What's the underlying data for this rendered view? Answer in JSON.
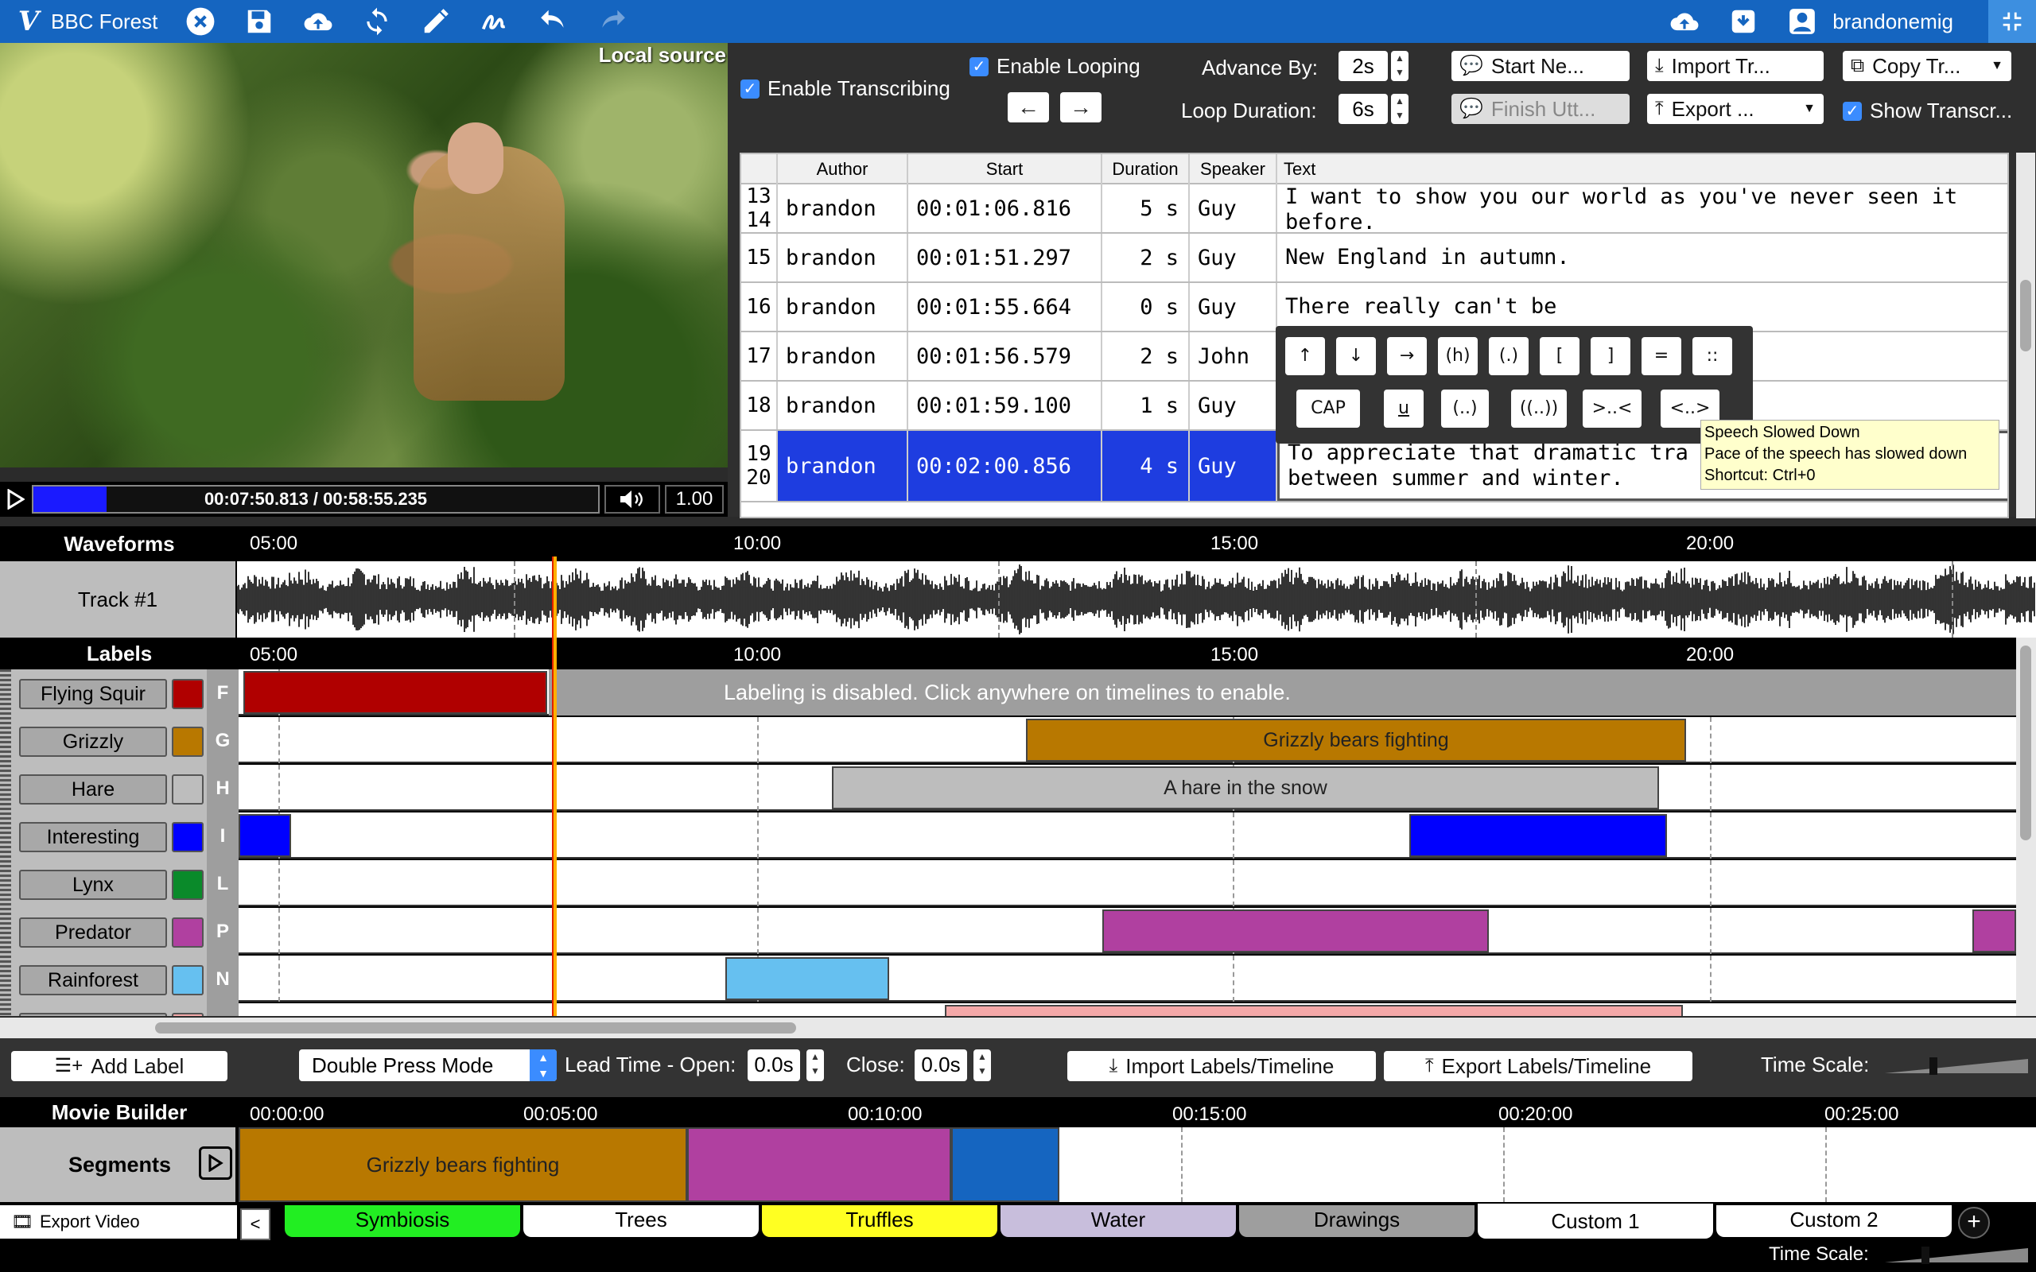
{
  "app": {
    "title": "BBC Forest",
    "user": "brandonemig"
  },
  "video": {
    "source_label": "Local source",
    "timecode": "00:07:50.813 / 00:58:55.235",
    "progress": 0.13,
    "rate": "1.00"
  },
  "transcription": {
    "enable_transcribing": "Enable Transcribing",
    "enable_looping": "Enable Looping",
    "advance_by_label": "Advance By:",
    "advance_by_value": "2s",
    "loop_duration_label": "Loop Duration:",
    "loop_duration_value": "6s",
    "start_new": "Start Ne...",
    "finish_utt": "Finish Utt...",
    "import_tr": "Import Tr...",
    "export": "Export ...",
    "copy_tr": "Copy Tr...",
    "show_transcr": "Show Transcr..."
  },
  "table": {
    "headers": [
      "Author",
      "Start",
      "Duration",
      "Speaker",
      "Text"
    ],
    "rows": [
      {
        "num": "13\n14",
        "author": "brandon",
        "start": "00:01:06.816",
        "duration": "5 s",
        "speaker": "Guy",
        "text": "I want to show you our world as you've never seen it before."
      },
      {
        "num": "15",
        "author": "brandon",
        "start": "00:01:51.297",
        "duration": "2 s",
        "speaker": "Guy",
        "text": "New England in autumn."
      },
      {
        "num": "16",
        "author": "brandon",
        "start": "00:01:55.664",
        "duration": "0 s",
        "speaker": "Guy",
        "text": "There really can't be"
      },
      {
        "num": "17",
        "author": "brandon",
        "start": "00:01:56.579",
        "duration": "2 s",
        "speaker": "John",
        "text": ""
      },
      {
        "num": "18",
        "author": "brandon",
        "start": "00:01:59.100",
        "duration": "1 s",
        "speaker": "Guy",
        "text": ""
      },
      {
        "num": "19\n20",
        "author": "brandon",
        "start": "00:02:00.856",
        "duration": "4 s",
        "speaker": "Guy",
        "text": "To appreciate that dramatic tra\nbetween summer and winter."
      }
    ]
  },
  "palette": {
    "row1": [
      "↑",
      "↓",
      "→",
      "(h)",
      "(.)",
      "[",
      "]",
      "=",
      "::"
    ],
    "row2": [
      "CAP",
      "u",
      "(..)",
      "((..))",
      ">..<",
      "<..>"
    ]
  },
  "tooltip": {
    "title": "Speech Slowed Down",
    "desc": "Pace of the speech has slowed down",
    "shortcut": "Shortcut: Ctrl+0"
  },
  "waveforms": {
    "header": "Waveforms",
    "track": "Track #1",
    "ticks": [
      "05:00",
      "10:00",
      "15:00",
      "20:00"
    ]
  },
  "labels": {
    "header": "Labels",
    "ticks": [
      "05:00",
      "10:00",
      "15:00",
      "20:00"
    ],
    "disabled_message": "Labeling is disabled. Click anywhere on timelines to enable.",
    "rows": [
      {
        "name": "Flying Squir",
        "key": "F",
        "color": "#b00000"
      },
      {
        "name": "Grizzly",
        "key": "G",
        "color": "#b87800"
      },
      {
        "name": "Hare",
        "key": "H",
        "color": "#bdbdbd"
      },
      {
        "name": "Interesting",
        "key": "I",
        "color": "#0000ff"
      },
      {
        "name": "Lynx",
        "key": "L",
        "color": "#0a8a2a"
      },
      {
        "name": "Predator",
        "key": "P",
        "color": "#b040a0"
      },
      {
        "name": "Rainforest",
        "key": "N",
        "color": "#66c0f0"
      }
    ],
    "segment_grizzly": "Grizzly bears fighting",
    "segment_hare": "A hare in the snow"
  },
  "toolbar": {
    "add_label": "Add Label",
    "mode": "Double Press Mode",
    "lead_open_label": "Lead Time - Open:",
    "lead_open_value": "0.0s",
    "close_label": "Close:",
    "close_value": "0.0s",
    "import_labels": "Import Labels/Timeline",
    "export_labels": "Export Labels/Timeline",
    "time_scale": "Time Scale:"
  },
  "movie": {
    "header": "Movie Builder",
    "ticks": [
      "00:00:00",
      "00:05:00",
      "00:10:00",
      "00:15:00",
      "00:20:00",
      "00:25:00"
    ],
    "segments_label": "Segments",
    "segment1": "Grizzly bears fighting",
    "export_video": "Export Video",
    "prev": "<",
    "tabs": [
      {
        "label": "Symbiosis",
        "color": "#22ee22"
      },
      {
        "label": "Trees",
        "color": "#ffffff"
      },
      {
        "label": "Truffles",
        "color": "#ffff22"
      },
      {
        "label": "Water",
        "color": "#c8bedc"
      },
      {
        "label": "Drawings",
        "color": "#9e9e9e"
      },
      {
        "label": "Custom 1",
        "color": "#ffffff"
      },
      {
        "label": "Custom 2",
        "color": "#ffffff"
      }
    ],
    "add_tab": "+",
    "time_scale": "Time Scale:"
  }
}
